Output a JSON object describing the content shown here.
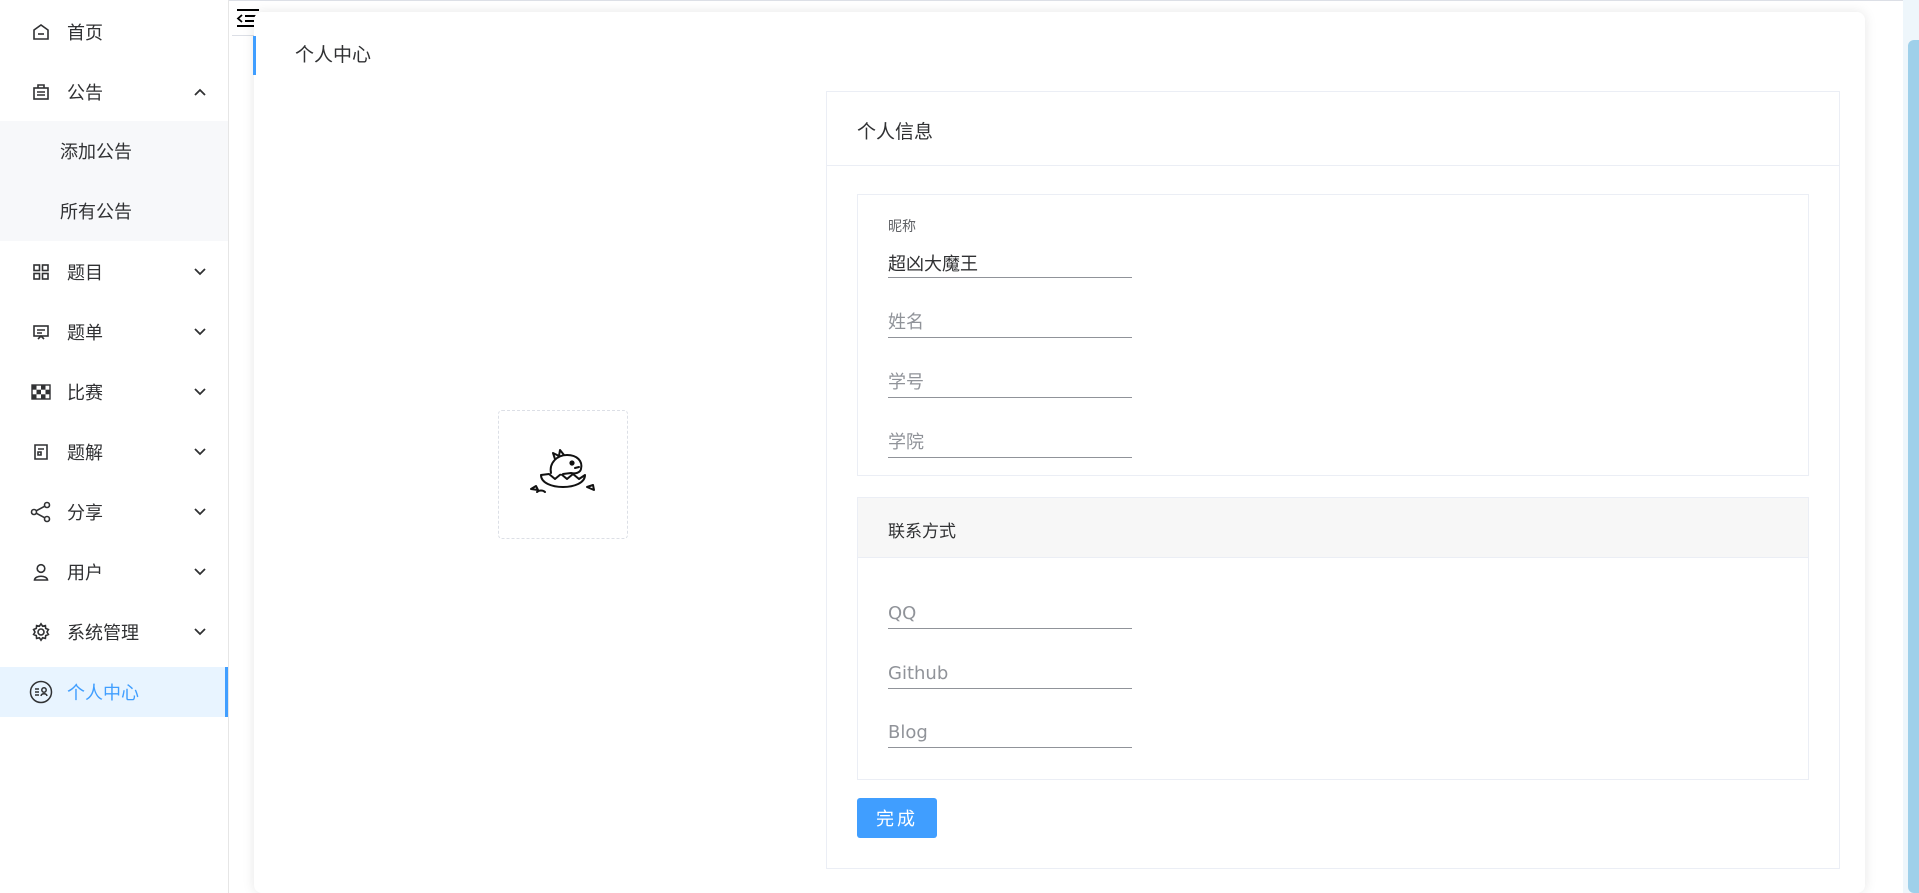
{
  "sidebar": {
    "items": [
      {
        "label": "首页",
        "icon": "home-icon"
      },
      {
        "label": "公告",
        "icon": "notice-icon",
        "expanded": true,
        "children": [
          {
            "label": "添加公告"
          },
          {
            "label": "所有公告"
          }
        ]
      },
      {
        "label": "题目",
        "icon": "grid-icon"
      },
      {
        "label": "题单",
        "icon": "board-icon"
      },
      {
        "label": "比赛",
        "icon": "checkered-flag-icon"
      },
      {
        "label": "题解",
        "icon": "solution-icon"
      },
      {
        "label": "分享",
        "icon": "share-icon"
      },
      {
        "label": "用户",
        "icon": "user-icon"
      },
      {
        "label": "系统管理",
        "icon": "gear-icon"
      },
      {
        "label": "个人中心",
        "icon": "profile-icon",
        "active": true
      }
    ]
  },
  "page": {
    "title": "个人中心"
  },
  "avatar": {
    "icon": "hatching-dinosaur-avatar"
  },
  "info": {
    "header": "个人信息",
    "nickname_label": "昵称",
    "nickname_value": "超凶大魔王",
    "name_placeholder": "姓名",
    "student_id_placeholder": "学号",
    "college_placeholder": "学院"
  },
  "contact": {
    "header": "联系方式",
    "qq_placeholder": "QQ",
    "github_placeholder": "Github",
    "blog_placeholder": "Blog"
  },
  "actions": {
    "submit_label": "完成"
  },
  "colors": {
    "accent": "#409eff",
    "active_bg": "#e8f4ff"
  }
}
